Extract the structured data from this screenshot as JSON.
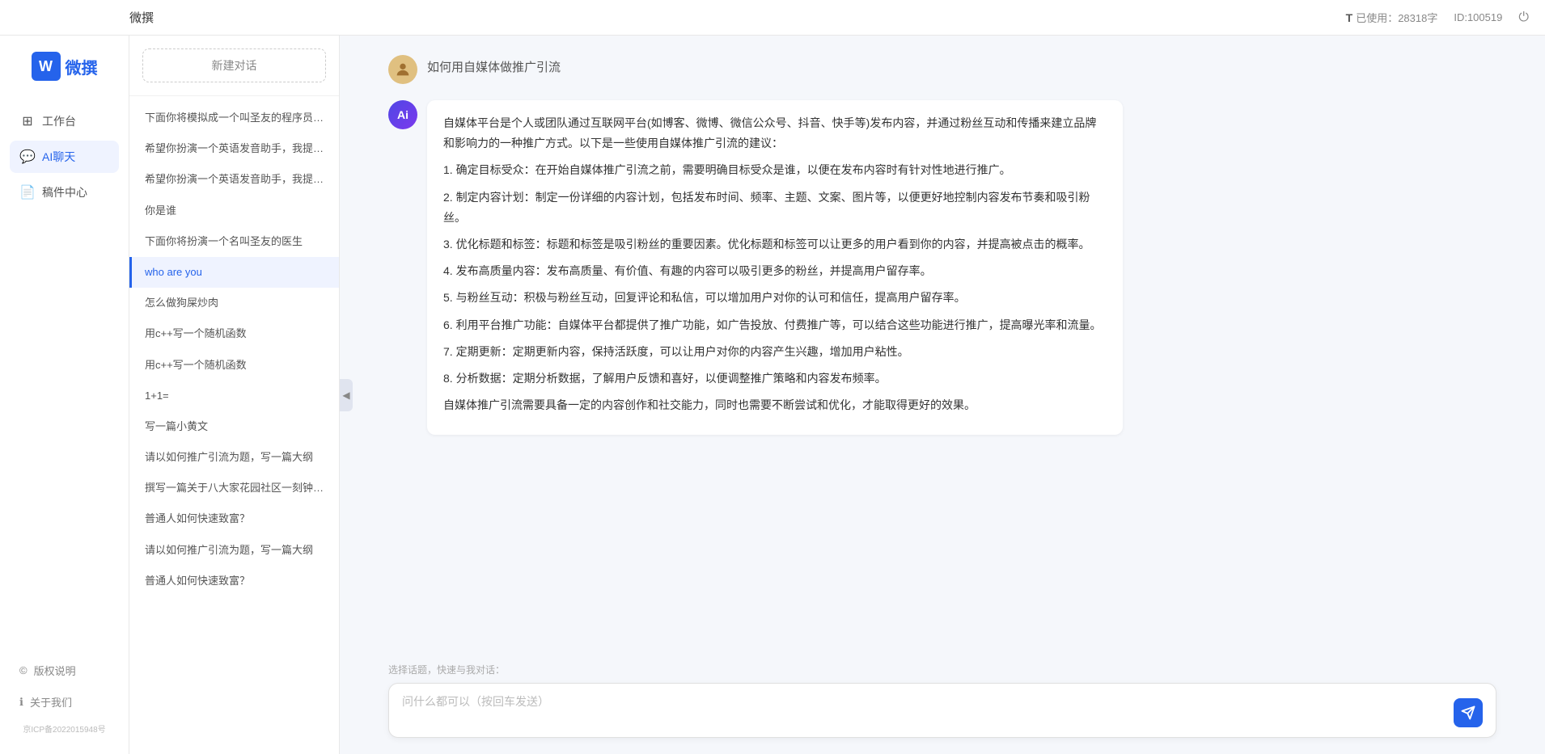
{
  "app": {
    "title": "微撰",
    "logo_letter": "W",
    "logo_text": "微撰"
  },
  "header": {
    "title": "微撰",
    "word_count_label": "已使用：28318字",
    "id_label": "ID:100519",
    "word_icon": "T"
  },
  "sidebar": {
    "nav_items": [
      {
        "id": "workspace",
        "label": "工作台",
        "icon": "⊞"
      },
      {
        "id": "ai-chat",
        "label": "AI聊天",
        "icon": "💬",
        "active": true
      },
      {
        "id": "drafts",
        "label": "稿件中心",
        "icon": "📄"
      }
    ],
    "bottom_items": [
      {
        "id": "copyright",
        "label": "版权说明",
        "icon": "©"
      },
      {
        "id": "about",
        "label": "关于我们",
        "icon": "ℹ"
      }
    ],
    "icp": "京ICP备2022015948号"
  },
  "conversation_list": {
    "new_button_label": "新建对话",
    "items": [
      {
        "id": "1",
        "title": "下面你将模拟成一个叫圣友的程序员、我说..."
      },
      {
        "id": "2",
        "title": "希望你扮演一个英语发音助手，我提供给你..."
      },
      {
        "id": "3",
        "title": "希望你扮演一个英语发音助手，我提供给你..."
      },
      {
        "id": "4",
        "title": "你是谁"
      },
      {
        "id": "5",
        "title": "下面你将扮演一个名叫圣友的医生"
      },
      {
        "id": "6",
        "title": "who are you",
        "active": true
      },
      {
        "id": "7",
        "title": "怎么做狗屎炒肉"
      },
      {
        "id": "8",
        "title": "用c++写一个随机函数"
      },
      {
        "id": "9",
        "title": "用c++写一个随机函数"
      },
      {
        "id": "10",
        "title": "1+1="
      },
      {
        "id": "11",
        "title": "写一篇小黄文"
      },
      {
        "id": "12",
        "title": "请以如何推广引流为题，写一篇大纲"
      },
      {
        "id": "13",
        "title": "撰写一篇关于八大家花园社区一刻钟便民生..."
      },
      {
        "id": "14",
        "title": "普通人如何快速致富？"
      },
      {
        "id": "15",
        "title": "请以如何推广引流为题，写一篇大纲"
      },
      {
        "id": "16",
        "title": "普通人如何快速致富？"
      }
    ]
  },
  "chat": {
    "user_message": "如何用自媒体做推广引流",
    "user_avatar_emoji": "👤",
    "ai_avatar_text": "Ai",
    "ai_response": {
      "intro": "自媒体平台是个人或团队通过互联网平台(如博客、微博、微信公众号、抖音、快手等)发布内容，并通过粉丝互动和传播来建立品牌和影响力的一种推广方式。以下是一些使用自媒体推广引流的建议：",
      "points": [
        "1. 确定目标受众：在开始自媒体推广引流之前，需要明确目标受众是谁，以便在发布内容时有针对性地进行推广。",
        "2. 制定内容计划：制定一份详细的内容计划，包括发布时间、频率、主题、文案、图片等，以便更好地控制内容发布节奏和吸引粉丝。",
        "3. 优化标题和标签：标题和标签是吸引粉丝的重要因素。优化标题和标签可以让更多的用户看到你的内容，并提高被点击的概率。",
        "4. 发布高质量内容：发布高质量、有价值、有趣的内容可以吸引更多的粉丝，并提高用户留存率。",
        "5. 与粉丝互动：积极与粉丝互动，回复评论和私信，可以增加用户对你的认可和信任，提高用户留存率。",
        "6. 利用平台推广功能：自媒体平台都提供了推广功能，如广告投放、付费推广等，可以结合这些功能进行推广，提高曝光率和流量。",
        "7. 定期更新：定期更新内容，保持活跃度，可以让用户对你的内容产生兴趣，增加用户粘性。",
        "8. 分析数据：定期分析数据，了解用户反馈和喜好，以便调整推广策略和内容发布频率。"
      ],
      "outro": "自媒体推广引流需要具备一定的内容创作和社交能力，同时也需要不断尝试和优化，才能取得更好的效果。"
    }
  },
  "input": {
    "quick_prompt_label": "选择话题，快速与我对话：",
    "placeholder": "问什么都可以（按回车发送）"
  }
}
